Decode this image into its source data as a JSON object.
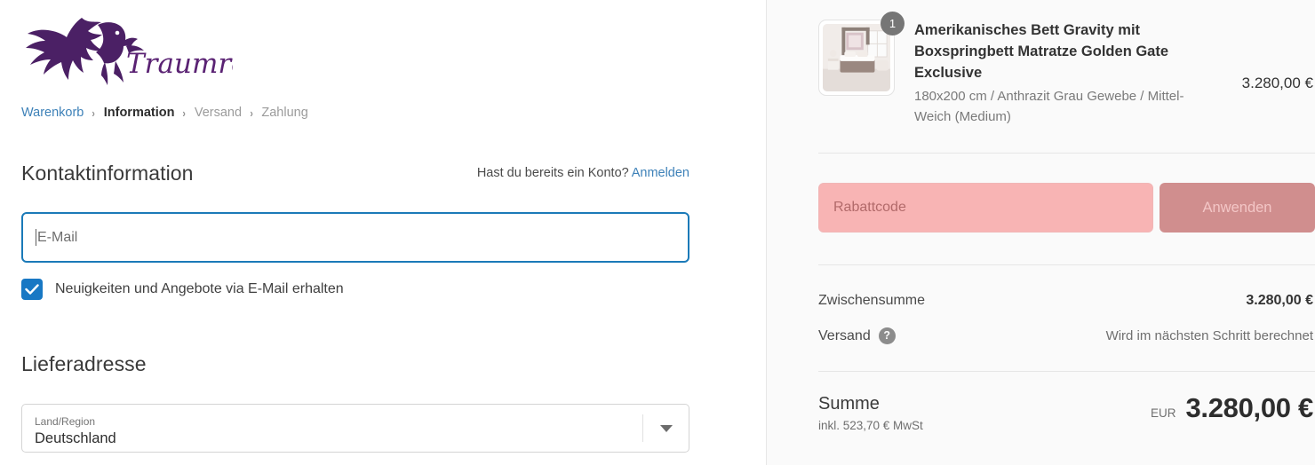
{
  "brand": {
    "name": "Traumreiter",
    "logo_icon": "pegasus-logo",
    "color": "#4b2065"
  },
  "breadcrumb": {
    "items": [
      {
        "label": "Warenkorb",
        "state": "link"
      },
      {
        "label": "Information",
        "state": "current"
      },
      {
        "label": "Versand",
        "state": "muted"
      },
      {
        "label": "Zahlung",
        "state": "muted"
      }
    ],
    "separator": "›"
  },
  "contact": {
    "title": "Kontaktinformation",
    "account_question": "Hast du bereits ein Konto?",
    "login_label": "Anmelden",
    "email": {
      "value": "",
      "placeholder": "E-Mail"
    },
    "newsletter": {
      "label": "Neuigkeiten und Angebote via E-Mail erhalten",
      "checked": true,
      "check_icon": "checkmark-icon"
    }
  },
  "shipping_address": {
    "title": "Lieferadresse",
    "country": {
      "label": "Land/Region",
      "value": "Deutschland",
      "arrow_icon": "chevron-down-icon"
    }
  },
  "summary": {
    "product": {
      "quantity": "1",
      "title": "Amerikanisches Bett Gravity mit Boxspringbett Matratze Golden Gate Exclusive",
      "variant": "180x200 cm / Anthrazit Grau Gewebe / Mittel-Weich (Medium)",
      "price": "3.280,00 €",
      "thumbnail_icon": "bedroom-product-image"
    },
    "discount": {
      "placeholder": "Rabattcode",
      "value": "",
      "apply_label": "Anwenden",
      "input_color": "#f8b4b4",
      "button_color": "#d08e8e"
    },
    "subtotal": {
      "label": "Zwischensumme",
      "value": "3.280,00 €"
    },
    "shipping": {
      "label": "Versand",
      "help_icon": "question-mark-icon",
      "note": "Wird im nächsten Schritt berechnet"
    },
    "total": {
      "label": "Summe",
      "tax_note": "inkl. 523,70 € MwSt",
      "currency": "EUR",
      "amount": "3.280,00 €"
    }
  }
}
